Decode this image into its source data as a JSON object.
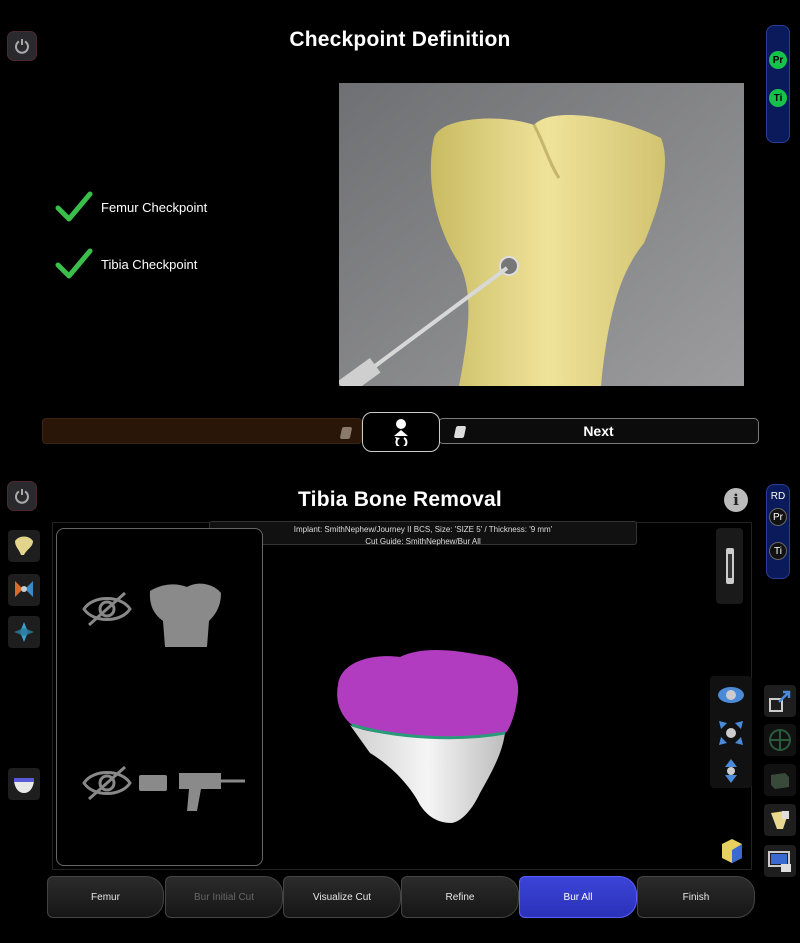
{
  "top": {
    "title": "Checkpoint Definition",
    "checkpoints": [
      {
        "label": "Femur Checkpoint",
        "done": true
      },
      {
        "label": "Tibia Checkpoint",
        "done": true
      }
    ],
    "side_tabs": [
      "Pr",
      "Ti"
    ],
    "next_label": "Next",
    "progress": 0.75
  },
  "bottom": {
    "title": "Tibia Bone Removal",
    "side_tabs": [
      "RD",
      "Pr",
      "Ti"
    ],
    "implant_line": "Implant:  SmithNephew/Journey II BCS, Size:  'SIZE 5' / Thickness:  '9 mm'",
    "cut_guide_line": "Cut Guide:  SmithNephew/Bur All",
    "tabs": [
      {
        "label": "Femur",
        "state": "normal"
      },
      {
        "label": "Bur Initial Cut",
        "state": "disabled"
      },
      {
        "label": "Visualize Cut",
        "state": "normal"
      },
      {
        "label": "Refine",
        "state": "normal"
      },
      {
        "label": "Bur All",
        "state": "active"
      },
      {
        "label": "Finish",
        "state": "normal"
      }
    ]
  },
  "colors": {
    "check_green": "#3ac04a",
    "active_tab": "#2f37c8",
    "bone_magenta": "#b13cc0",
    "bone_white": "#e8e8e8"
  }
}
